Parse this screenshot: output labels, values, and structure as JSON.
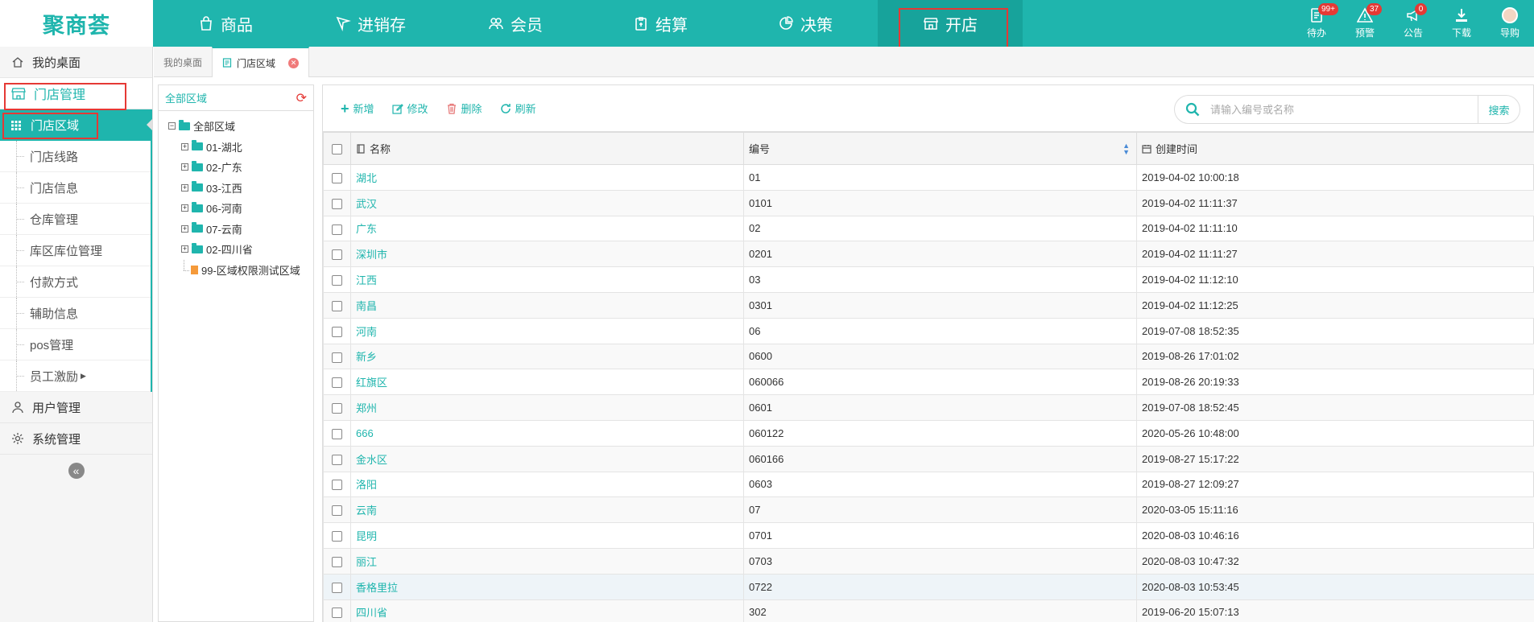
{
  "app": {
    "logo": "聚商荟"
  },
  "nav": {
    "items": [
      {
        "label": "商品",
        "icon": "bag-icon"
      },
      {
        "label": "进销存",
        "icon": "flag-icon"
      },
      {
        "label": "会员",
        "icon": "users-icon"
      },
      {
        "label": "结算",
        "icon": "clipboard-icon"
      },
      {
        "label": "决策",
        "icon": "chart-icon"
      },
      {
        "label": "开店",
        "icon": "store-icon"
      }
    ]
  },
  "topright": {
    "items": [
      {
        "label": "待办",
        "badge": "99+",
        "icon": "todo-icon"
      },
      {
        "label": "预警",
        "badge": "37",
        "icon": "warning-icon"
      },
      {
        "label": "公告",
        "badge": "0",
        "icon": "megaphone-icon"
      },
      {
        "label": "下载",
        "icon": "download-icon"
      },
      {
        "label": "导购",
        "icon": "avatar-icon"
      }
    ]
  },
  "sidebar": {
    "desktop": "我的桌面",
    "store_mgmt": "门店管理",
    "active": "门店区域",
    "subs": [
      "门店线路",
      "门店信息",
      "仓库管理",
      "库区库位管理",
      "付款方式",
      "辅助信息",
      "pos管理",
      "员工激励"
    ],
    "user_mgmt": "用户管理",
    "sys_mgmt": "系统管理"
  },
  "tabs": {
    "desktop": "我的桌面",
    "current": "门店区域"
  },
  "tree": {
    "header": "全部区域",
    "root": "全部区域",
    "children": [
      "01-湖北",
      "02-广东",
      "03-江西",
      "06-河南",
      "07-云南",
      "02-四川省"
    ],
    "leaf": "99-区域权限测试区域"
  },
  "toolbar": {
    "add": "新增",
    "edit": "修改",
    "delete": "删除",
    "refresh": "刷新",
    "search_placeholder": "请输入编号或名称",
    "search_btn": "搜索"
  },
  "table": {
    "columns": {
      "name": "名称",
      "code": "编号",
      "created": "创建时间"
    },
    "rows": [
      {
        "name": "湖北",
        "code": "01",
        "created": "2019-04-02 10:00:18"
      },
      {
        "name": "武汉",
        "code": "0101",
        "created": "2019-04-02 11:11:37"
      },
      {
        "name": "广东",
        "code": "02",
        "created": "2019-04-02 11:11:10"
      },
      {
        "name": "深圳市",
        "code": "0201",
        "created": "2019-04-02 11:11:27"
      },
      {
        "name": "江西",
        "code": "03",
        "created": "2019-04-02 11:12:10"
      },
      {
        "name": "南昌",
        "code": "0301",
        "created": "2019-04-02 11:12:25"
      },
      {
        "name": "河南",
        "code": "06",
        "created": "2019-07-08 18:52:35"
      },
      {
        "name": "新乡",
        "code": "0600",
        "created": "2019-08-26 17:01:02"
      },
      {
        "name": "红旗区",
        "code": "060066",
        "created": "2019-08-26 20:19:33"
      },
      {
        "name": "郑州",
        "code": "0601",
        "created": "2019-07-08 18:52:45"
      },
      {
        "name": "666",
        "code": "060122",
        "created": "2020-05-26 10:48:00"
      },
      {
        "name": "金水区",
        "code": "060166",
        "created": "2019-08-27 15:17:22"
      },
      {
        "name": "洛阳",
        "code": "0603",
        "created": "2019-08-27 12:09:27"
      },
      {
        "name": "云南",
        "code": "07",
        "created": "2020-03-05 15:11:16"
      },
      {
        "name": "昆明",
        "code": "0701",
        "created": "2020-08-03 10:46:16"
      },
      {
        "name": "丽江",
        "code": "0703",
        "created": "2020-08-03 10:47:32"
      },
      {
        "name": "香格里拉",
        "code": "0722",
        "created": "2020-08-03 10:53:45"
      },
      {
        "name": "四川省",
        "code": "302",
        "created": "2019-06-20 15:07:13"
      }
    ]
  },
  "colors": {
    "accent": "#1fb5ad",
    "highlight": "#e53935"
  }
}
